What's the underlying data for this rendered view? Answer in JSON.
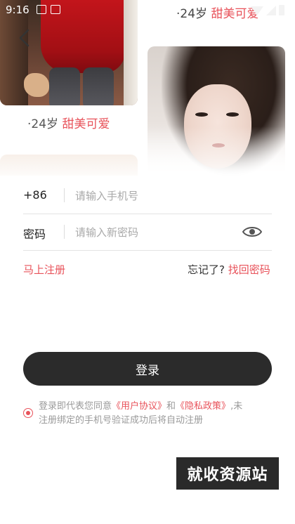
{
  "status_bar": {
    "time": "9:16"
  },
  "cards": {
    "left_caption": {
      "age": "·24岁",
      "tag": "甜美可爱"
    },
    "top_caption": {
      "age": "·24岁",
      "tag": "甜美可爱"
    }
  },
  "form": {
    "phone_prefix": "+86",
    "phone_placeholder": "请输入手机号",
    "password_label": "密码",
    "password_placeholder": "请输入新密码"
  },
  "links": {
    "register": "马上注册",
    "forgot_question": "忘记了?",
    "forgot_action": "找回密码"
  },
  "login_button": "登录",
  "agreement": {
    "prefix": "登录即代表您同意",
    "user_agreement": "《用户协议》",
    "and": "和",
    "privacy_policy": "《隐私政策》",
    "suffix": ",未注册绑定的手机号验证成功后将自动注册"
  },
  "watermark": "就收资源站",
  "colors": {
    "accent": "#e8525a",
    "button": "#2b2b2b"
  }
}
